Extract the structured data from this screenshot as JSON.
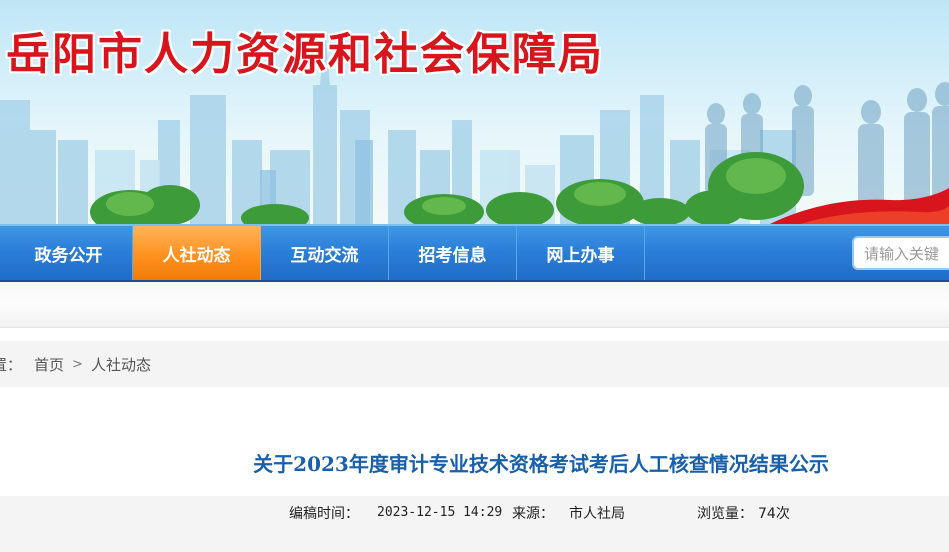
{
  "header": {
    "site_title": "岳阳市人力资源和社会保障局"
  },
  "nav": {
    "items": [
      {
        "label": "政务公开",
        "active": false
      },
      {
        "label": "人社动态",
        "active": true
      },
      {
        "label": "互动交流",
        "active": false
      },
      {
        "label": "招考信息",
        "active": false
      },
      {
        "label": "网上办事",
        "active": false
      }
    ],
    "search_placeholder": "请输入关键"
  },
  "breadcrumb": {
    "lead": "置：",
    "home": "首页",
    "separator": ">",
    "current": "人社动态"
  },
  "article": {
    "title": "关于2023年度审计专业技术资格考试考后人工核查情况结果公示",
    "meta": {
      "publish_label": "编稿时间：",
      "publish_value": "2023-12-15 14:29",
      "source_label": "来源：",
      "source_value": "市人社局",
      "views_label": "浏览量：",
      "views_value": "74次"
    }
  },
  "colors": {
    "nav_blue": "#2c7fd8",
    "nav_active": "#ff8f1a",
    "title_red": "#d8141c",
    "article_title": "#1960ab"
  }
}
